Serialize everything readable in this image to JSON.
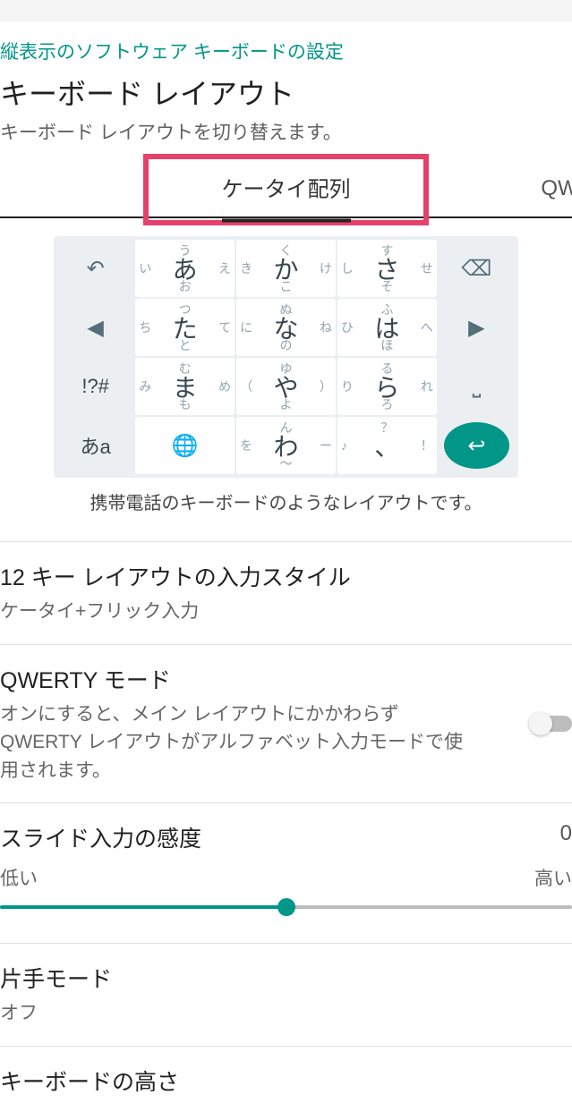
{
  "breadcrumb": "縦表示のソフトウェア キーボードの設定",
  "title": "キーボード レイアウト",
  "subtitle": "キーボード レイアウトを切り替えます。",
  "tabs": {
    "center": "ケータイ配列",
    "right": "QWER"
  },
  "keyboard": {
    "caption": "携帯電話のキーボードのようなレイアウトです。",
    "rows": [
      [
        {
          "type": "icon",
          "name": "undo-icon",
          "glyph": "↶"
        },
        {
          "type": "flick",
          "center": "あ",
          "top": "う",
          "bottom": "お",
          "left": "い",
          "right": "え"
        },
        {
          "type": "flick",
          "center": "か",
          "top": "く",
          "bottom": "こ",
          "left": "き",
          "right": "け"
        },
        {
          "type": "flick",
          "center": "さ",
          "top": "す",
          "bottom": "そ",
          "left": "し",
          "right": "せ"
        },
        {
          "type": "icon",
          "name": "backspace-icon",
          "glyph": "⌫"
        }
      ],
      [
        {
          "type": "icon",
          "name": "left-arrow-icon",
          "glyph": "◀"
        },
        {
          "type": "flick",
          "center": "た",
          "top": "つ",
          "bottom": "と",
          "left": "ち",
          "right": "て"
        },
        {
          "type": "flick",
          "center": "な",
          "top": "ぬ",
          "bottom": "の",
          "left": "に",
          "right": "ね"
        },
        {
          "type": "flick",
          "center": "は",
          "top": "ふ",
          "bottom": "ほ",
          "left": "ひ",
          "right": "へ"
        },
        {
          "type": "icon",
          "name": "right-arrow-icon",
          "glyph": "▶"
        }
      ],
      [
        {
          "type": "text",
          "label": "!?#",
          "name": "symbols-key"
        },
        {
          "type": "flick",
          "center": "ま",
          "top": "む",
          "bottom": "も",
          "left": "み",
          "right": "め"
        },
        {
          "type": "flick",
          "center": "や",
          "top": "ゆ",
          "bottom": "よ",
          "left": "（",
          "right": "）"
        },
        {
          "type": "flick",
          "center": "ら",
          "top": "る",
          "bottom": "ろ",
          "left": "り",
          "right": "れ"
        },
        {
          "type": "icon",
          "name": "space-icon",
          "glyph": "⎵"
        }
      ],
      [
        {
          "type": "text",
          "label": "あa",
          "name": "mode-key"
        },
        {
          "type": "icon",
          "name": "globe-icon",
          "glyph": "🌐"
        },
        {
          "type": "flick",
          "center": "わ",
          "top": "ん",
          "bottom": "〜",
          "left": "を",
          "right": "ー"
        },
        {
          "type": "flick",
          "center": "、",
          "top": "？",
          "bottom": " ",
          "left": "♪",
          "right": "！"
        },
        {
          "type": "enter",
          "name": "enter-icon",
          "glyph": "↩"
        }
      ]
    ]
  },
  "settings": {
    "input_style": {
      "title": "12 キー レイアウトの入力スタイル",
      "desc": "ケータイ+フリック入力"
    },
    "qwerty_mode": {
      "title": "QWERTY モード",
      "desc": "オンにすると、メイン レイアウトにかかわらず QWERTY レイアウトがアルファベット入力モードで使用されます。",
      "value": false
    },
    "slide_sensitivity": {
      "title": "スライド入力の感度",
      "value_label": "0",
      "low": "低い",
      "high": "高い",
      "percent": 50
    },
    "one_hand": {
      "title": "片手モード",
      "desc": "オフ"
    },
    "last": {
      "title": "キーボードの高さ"
    }
  }
}
